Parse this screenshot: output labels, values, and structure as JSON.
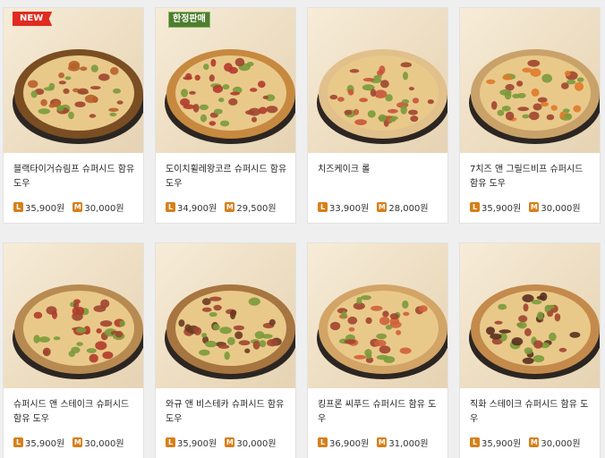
{
  "menu": {
    "size_large": "L",
    "size_medium": "M",
    "items": [
      {
        "name": "블랙타이거슈림프 슈퍼시드 함유 도우",
        "badge": "NEW",
        "price_l": "35,900원",
        "price_m": "30,000원",
        "crust": "#7a4e22",
        "topping": "#b8612a"
      },
      {
        "name": "도이치휠레왕코르 슈퍼시드 함유 도우",
        "badge": "한정판매",
        "price_l": "34,900원",
        "price_m": "29,500원",
        "crust": "#c7893f",
        "topping": "#b23a2c"
      },
      {
        "name": "치즈케이크 롤",
        "badge": "",
        "price_l": "33,900원",
        "price_m": "28,000원",
        "crust": "#e2c08b",
        "topping": "#c9543a"
      },
      {
        "name": "7치즈 앤 그릴드비프 슈퍼시드 함유 도우",
        "badge": "",
        "price_l": "35,900원",
        "price_m": "30,000원",
        "crust": "#c9a26a",
        "topping": "#e07a2a"
      },
      {
        "name": "슈퍼시드 앤 스테이크 슈퍼시드 함유 도우",
        "badge": "",
        "price_l": "35,900원",
        "price_m": "30,000원",
        "crust": "#b78a52",
        "topping": "#b33a2a"
      },
      {
        "name": "와규 앤 비스테카 슈퍼시드 함유 도우",
        "badge": "",
        "price_l": "35,900원",
        "price_m": "30,000원",
        "crust": "#a67540",
        "topping": "#6b3a22"
      },
      {
        "name": "킹프론 씨푸드 슈퍼시드 함유 도우",
        "badge": "",
        "price_l": "36,900원",
        "price_m": "31,000원",
        "crust": "#d2a466",
        "topping": "#d0603a"
      },
      {
        "name": "직화 스테이크 슈퍼시드 함유 도우",
        "badge": "",
        "price_l": "35,900원",
        "price_m": "30,000원",
        "crust": "#c48a4c",
        "topping": "#5a2f1e"
      }
    ]
  }
}
